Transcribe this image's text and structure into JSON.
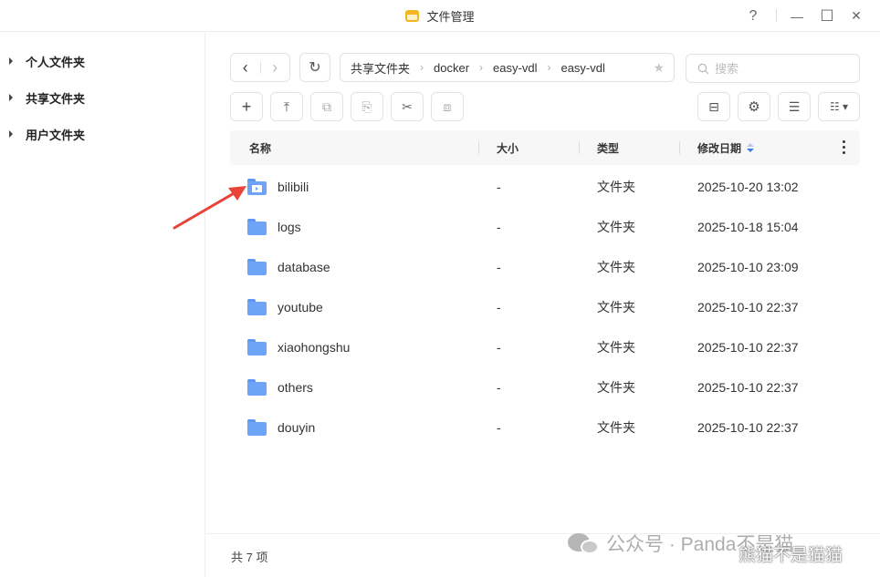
{
  "window": {
    "title": "文件管理",
    "controls": {
      "help": "?",
      "minimize": "—",
      "maximize": "☐",
      "close": "✕"
    }
  },
  "sidebar": {
    "items": [
      {
        "label": "个人文件夹",
        "icon": "caret-right-icon"
      },
      {
        "label": "共享文件夹",
        "icon": "caret-right-icon"
      },
      {
        "label": "用户文件夹",
        "icon": "caret-right-icon"
      }
    ]
  },
  "toolbar": {
    "back_icon": "‹",
    "forward_icon": "›",
    "refresh_icon": "↻",
    "breadcrumb": [
      "共享文件夹",
      "docker",
      "easy-vdl",
      "easy-vdl"
    ],
    "breadcrumb_sep": "›",
    "favorite_icon": "★",
    "search_placeholder": "搜索",
    "actions": [
      {
        "name": "new-button",
        "glyph": "+"
      },
      {
        "name": "upload-button",
        "glyph": "⤒"
      },
      {
        "name": "copy-button",
        "glyph": "⧉"
      },
      {
        "name": "paste-button",
        "glyph": "⎘"
      },
      {
        "name": "cut-button",
        "glyph": "✂"
      },
      {
        "name": "move-button",
        "glyph": "⧈"
      }
    ],
    "right_actions": [
      {
        "name": "briefcase-button",
        "glyph": "⊟"
      },
      {
        "name": "settings-button",
        "glyph": "⚙"
      },
      {
        "name": "properties-button",
        "glyph": "☰"
      },
      {
        "name": "view-mode-button",
        "glyph": "☷ ▾"
      }
    ]
  },
  "table": {
    "columns": [
      "名称",
      "大小",
      "类型",
      "修改日期"
    ],
    "sorted_column": "修改日期",
    "rows": [
      {
        "name": "bilibili",
        "size": "-",
        "type": "文件夹",
        "modified": "2025-10-20 13:02",
        "special_icon": true
      },
      {
        "name": "logs",
        "size": "-",
        "type": "文件夹",
        "modified": "2025-10-18 15:04"
      },
      {
        "name": "database",
        "size": "-",
        "type": "文件夹",
        "modified": "2025-10-10 23:09"
      },
      {
        "name": "youtube",
        "size": "-",
        "type": "文件夹",
        "modified": "2025-10-10 22:37"
      },
      {
        "name": "xiaohongshu",
        "size": "-",
        "type": "文件夹",
        "modified": "2025-10-10 22:37"
      },
      {
        "name": "others",
        "size": "-",
        "type": "文件夹",
        "modified": "2025-10-10 22:37"
      },
      {
        "name": "douyin",
        "size": "-",
        "type": "文件夹",
        "modified": "2025-10-10 22:37"
      }
    ]
  },
  "footer": {
    "count": "共 7 项"
  },
  "watermark": {
    "main": "公众号 · Panda不是猫",
    "sub": "熊猫不是猫猫"
  },
  "colors": {
    "accent": "#3c7cf0",
    "folder": "#6ea4f7",
    "arrow": "#e8443a",
    "app_icon": "#f2b620"
  }
}
